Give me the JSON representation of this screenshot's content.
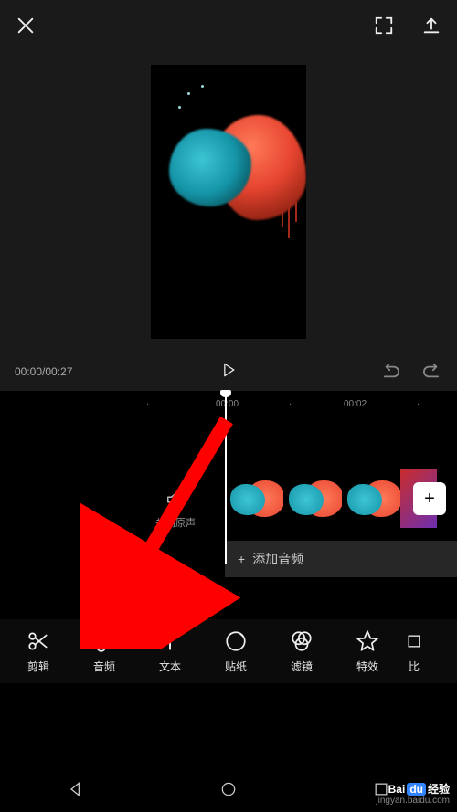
{
  "playback": {
    "current_time": "00:00",
    "total_time": "00:27"
  },
  "ruler": {
    "t0": "00:00",
    "t1": "00:02"
  },
  "mute_label": "关闭原声",
  "audio_track": {
    "add_label": "添加音频"
  },
  "add_clip_label": "+",
  "tools": [
    {
      "label": "剪辑",
      "icon": "scissors"
    },
    {
      "label": "音频",
      "icon": "music-note"
    },
    {
      "label": "文本",
      "icon": "text"
    },
    {
      "label": "贴纸",
      "icon": "sticker"
    },
    {
      "label": "滤镜",
      "icon": "filter"
    },
    {
      "label": "特效",
      "icon": "star"
    },
    {
      "label": "比",
      "icon": ""
    }
  ],
  "watermark": {
    "brand_left": "Bai",
    "brand_mid": "du",
    "brand_right": "经验",
    "url": "jingyan.baidu.com"
  }
}
